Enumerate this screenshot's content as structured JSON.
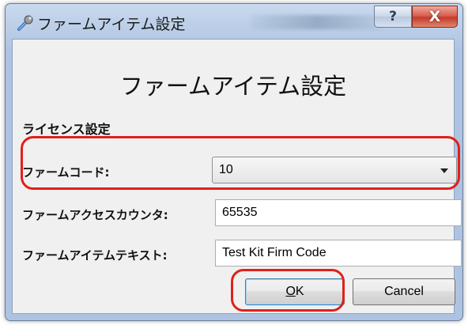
{
  "window": {
    "title": "ファームアイテム設定",
    "help_label": "?",
    "close_label": "X"
  },
  "dialog": {
    "header": "ファームアイテム設定",
    "section": "ライセンス設定",
    "fields": {
      "firm_code_label": "ファームコード:",
      "firm_code_value": "10",
      "access_counter_label": "ファームアクセスカウンタ:",
      "access_counter_value": "65535",
      "item_text_label": "ファームアイテムテキスト:",
      "item_text_value": "Test Kit Firm Code"
    },
    "buttons": {
      "ok_mnemonic": "O",
      "ok_rest": "K",
      "cancel": "Cancel"
    }
  },
  "colors": {
    "highlight_ring": "#e0201b",
    "title_bar": "#b7cbe6",
    "client_bg": "#f0f0f0"
  },
  "icons": [
    "wrench-icon",
    "help-icon",
    "close-icon",
    "dropdown-arrow-icon"
  ]
}
